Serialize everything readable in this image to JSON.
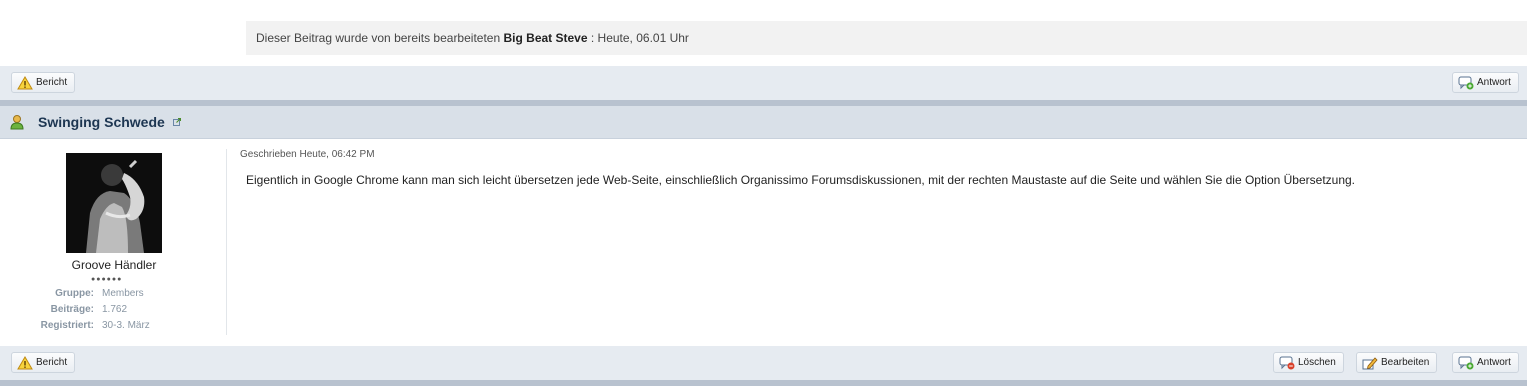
{
  "edit_note": {
    "prefix": "Dieser Beitrag wurde von bereits bearbeiteten",
    "editor": "Big Beat Steve",
    "suffix": ": Heute, 06.01 Uhr"
  },
  "top_bar": {
    "report_label": "Bericht",
    "reply_label": "Antwort"
  },
  "post": {
    "author": "Swinging Schwede",
    "user_title": "Groove Händler",
    "rank_pips": "●●●●●●",
    "info": [
      {
        "label": "Gruppe:",
        "value": "Members"
      },
      {
        "label": "Beiträge:",
        "value": "1.762"
      },
      {
        "label": "Registriert:",
        "value": "30-3. März"
      }
    ],
    "date": "Geschrieben Heute, 06:42 PM",
    "text": "Eigentlich in Google Chrome kann man sich leicht übersetzen jede Web-Seite, einschließlich Organissimo Forumsdiskussionen, mit der rechten Maustaste auf die Seite und wählen Sie die Option Übersetzung."
  },
  "bottom_bar": {
    "report_label": "Bericht",
    "delete_label": "Löschen",
    "edit_label": "Bearbeiten",
    "reply_label": "Antwort"
  },
  "icons": {
    "report": "warning-icon",
    "reply": "speech-bubble-add-icon",
    "delete": "speech-bubble-delete-icon",
    "edit": "pencil-icon",
    "user": "user-icon",
    "profile_link": "external-link-icon"
  },
  "colors": {
    "bar_bg": "#e6ebf1",
    "author_row_bg": "#d9e0e8",
    "separator": "#b8c2cf",
    "author_name": "#1d3652"
  }
}
